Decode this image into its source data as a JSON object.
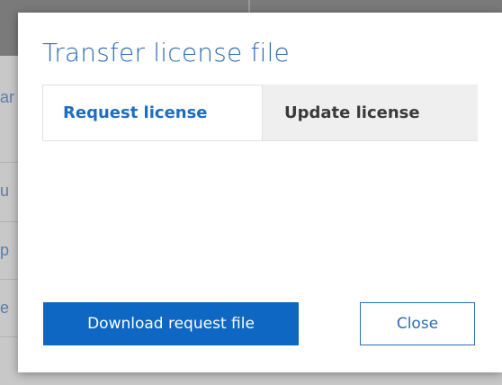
{
  "background": {
    "fragments": [
      "ar",
      "u",
      "p",
      "e"
    ]
  },
  "dialog": {
    "title": "Transfer license file",
    "tabs": [
      {
        "label": "Request license",
        "active": true
      },
      {
        "label": "Update license",
        "active": false
      }
    ],
    "buttons": {
      "download": "Download request file",
      "close": "Close"
    }
  },
  "colors": {
    "accent": "#0e67c2",
    "title": "#2d6db3",
    "overlay": "#c8c8c8"
  }
}
